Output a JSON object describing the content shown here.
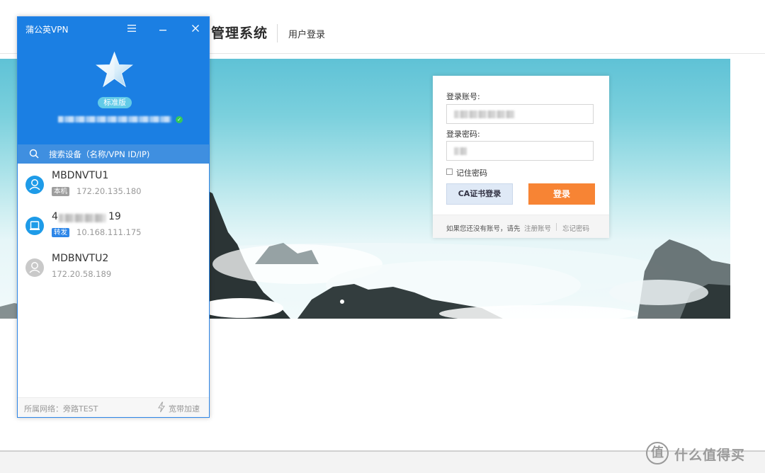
{
  "site": {
    "title_partial": "管理系统",
    "user_login": "用户登录"
  },
  "login_form": {
    "account_label": "登录账号:",
    "password_label": "登录密码:",
    "remember": "记住密码",
    "ca_button": "CA证书登录",
    "login_button": "登录",
    "footer_prompt": "如果您还没有账号，请先",
    "register_link": "注册账号",
    "forgot_link": "忘记密码"
  },
  "vpn": {
    "title": "蒲公英VPN",
    "edition": "标准版",
    "search_placeholder": "搜索设备（名称/VPN ID/IP)",
    "devices": [
      {
        "name": "MBDNVTU1",
        "tag": "本机",
        "ip": "172.20.135.180",
        "status": "online",
        "icon": "user-icon"
      },
      {
        "name_visible_start": "4",
        "name_visible_end": "19",
        "tag": "转发",
        "ip": "10.168.111.175",
        "status": "online",
        "icon": "router-icon"
      },
      {
        "name": "MDBNVTU2",
        "tag": "",
        "ip": "172.20.58.189",
        "status": "offline",
        "icon": "user-icon"
      }
    ],
    "footer_network": "所属网络：旁路TEST",
    "footer_speed": "宽带加速"
  },
  "watermark": {
    "glyph": "值",
    "text": "什么值得买"
  },
  "colors": {
    "vpn_blue": "#1b7fe3",
    "login_orange": "#f78434",
    "tag_gray": "#9e9e9e",
    "tag_blue": "#2d86e8",
    "online_blue": "#1e9be8"
  }
}
